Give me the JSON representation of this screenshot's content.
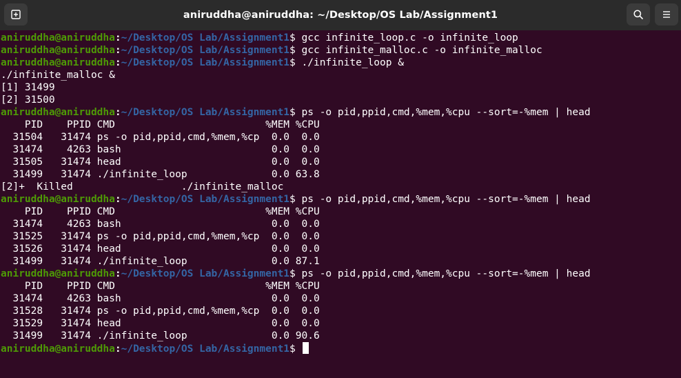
{
  "window": {
    "title": "aniruddha@aniruddha: ~/Desktop/OS Lab/Assignment1"
  },
  "toolbar": {
    "new_tab_icon": "new-tab-icon",
    "search_icon": "search-icon",
    "menu_icon": "hamburger-menu-icon"
  },
  "prompt": {
    "user": "aniruddha@aniruddha",
    "separator": ":",
    "path": "~/Desktop/OS Lab/Assignment1",
    "symbol": "$ "
  },
  "colors": {
    "background": "#300a24",
    "titlebar": "#2b2b2b",
    "user": "#4e9a06",
    "path": "#3465a4",
    "text": "#ffffff"
  },
  "lines": [
    {
      "type": "prompt",
      "cmd": "gcc infinite_loop.c -o infinite_loop"
    },
    {
      "type": "prompt",
      "cmd": "gcc infinite_malloc.c -o infinite_malloc"
    },
    {
      "type": "prompt",
      "cmd": "./infinite_loop &"
    },
    {
      "type": "output",
      "text": "./infinite_malloc &"
    },
    {
      "type": "output",
      "text": "[1] 31499"
    },
    {
      "type": "output",
      "text": "[2] 31500"
    },
    {
      "type": "prompt",
      "cmd": "ps -o pid,ppid,cmd,%mem,%cpu --sort=-%mem | head"
    },
    {
      "type": "output",
      "text": "    PID    PPID CMD                         %MEM %CPU"
    },
    {
      "type": "output",
      "text": "  31504   31474 ps -o pid,ppid,cmd,%mem,%cp  0.0  0.0"
    },
    {
      "type": "output",
      "text": "  31474    4263 bash                         0.0  0.0"
    },
    {
      "type": "output",
      "text": "  31505   31474 head                         0.0  0.0"
    },
    {
      "type": "output",
      "text": "  31499   31474 ./infinite_loop              0.0 63.8"
    },
    {
      "type": "output",
      "text": "[2]+  Killed                  ./infinite_malloc"
    },
    {
      "type": "prompt",
      "cmd": "ps -o pid,ppid,cmd,%mem,%cpu --sort=-%mem | head"
    },
    {
      "type": "output",
      "text": "    PID    PPID CMD                         %MEM %CPU"
    },
    {
      "type": "output",
      "text": "  31474    4263 bash                         0.0  0.0"
    },
    {
      "type": "output",
      "text": "  31525   31474 ps -o pid,ppid,cmd,%mem,%cp  0.0  0.0"
    },
    {
      "type": "output",
      "text": "  31526   31474 head                         0.0  0.0"
    },
    {
      "type": "output",
      "text": "  31499   31474 ./infinite_loop              0.0 87.1"
    },
    {
      "type": "prompt",
      "cmd": "ps -o pid,ppid,cmd,%mem,%cpu --sort=-%mem | head"
    },
    {
      "type": "output",
      "text": "    PID    PPID CMD                         %MEM %CPU"
    },
    {
      "type": "output",
      "text": "  31474    4263 bash                         0.0  0.0"
    },
    {
      "type": "output",
      "text": "  31528   31474 ps -o pid,ppid,cmd,%mem,%cp  0.0  0.0"
    },
    {
      "type": "output",
      "text": "  31529   31474 head                         0.0  0.0"
    },
    {
      "type": "output",
      "text": "  31499   31474 ./infinite_loop              0.0 90.6"
    },
    {
      "type": "prompt",
      "cmd": "",
      "cursor": true
    }
  ]
}
